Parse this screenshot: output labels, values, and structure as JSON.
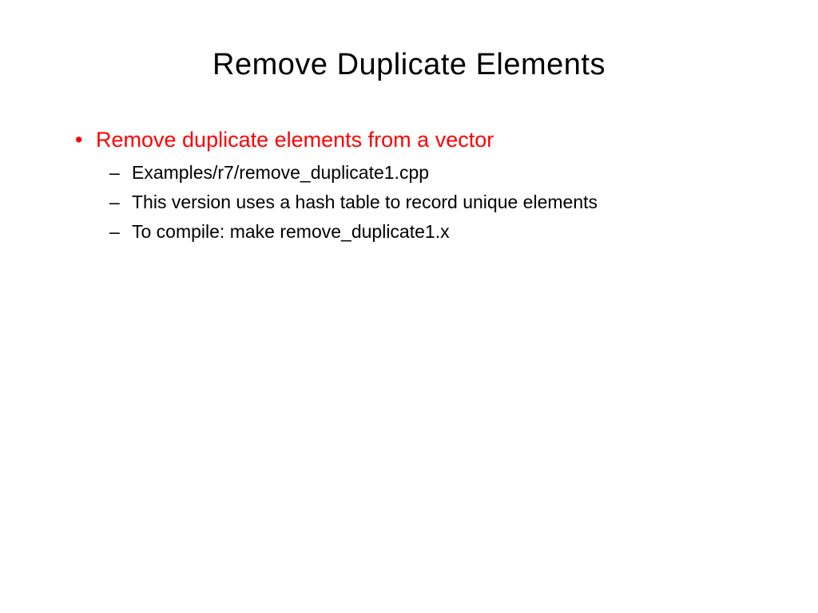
{
  "title": "Remove Duplicate Elements",
  "main_bullet": "Remove duplicate elements from a vector",
  "sub_bullets": [
    "Examples/r7/remove_duplicate1.cpp",
    "This version uses a hash table to record unique elements",
    "To compile: make remove_duplicate1.x"
  ]
}
